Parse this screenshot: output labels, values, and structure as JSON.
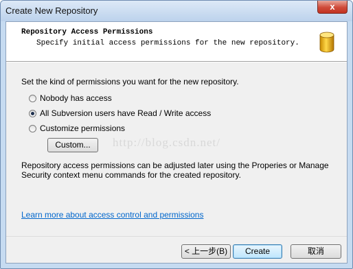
{
  "window": {
    "title": "Create New Repository",
    "close_label": "x"
  },
  "header": {
    "title": "Repository Access Permissions",
    "subtitle": "Specify initial access permissions for the new repository.",
    "icon": "database-icon"
  },
  "body": {
    "prompt": "Set the kind of permissions you want for the new repository.",
    "options": [
      {
        "label": "Nobody has access",
        "checked": false
      },
      {
        "label": "All Subversion users have Read / Write access",
        "checked": true
      },
      {
        "label": "Customize permissions",
        "checked": false
      }
    ],
    "custom_button": "Custom...",
    "info": "Repository access permissions can be adjusted later using the Properies or Manage Security context menu commands for the created repository.",
    "learn_more": "Learn more about access control and permissions",
    "watermark": "http://blog.csdn.net/"
  },
  "buttons": {
    "back": "< 上一步(B)",
    "create": "Create",
    "cancel": "取消"
  },
  "colors": {
    "accent": "#3c7fb1",
    "link": "#0066cc",
    "titlebar": "#c6dbf1",
    "close": "#c23322"
  }
}
